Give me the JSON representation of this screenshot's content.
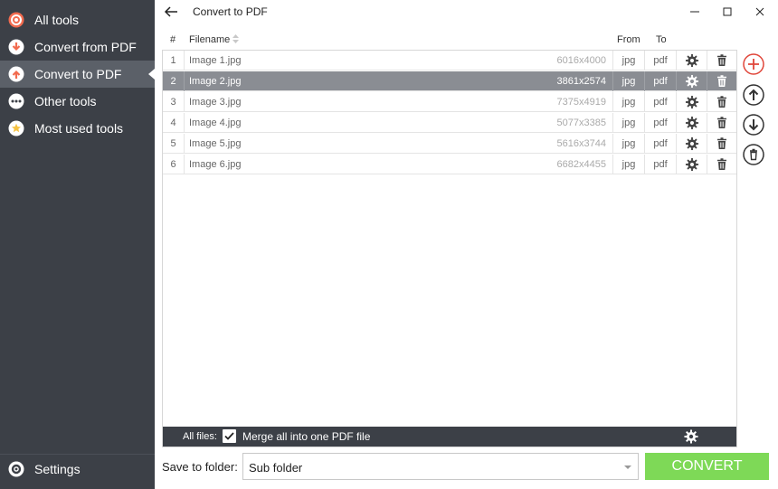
{
  "sidebar": {
    "items": [
      {
        "label": "All tools",
        "icon": "target-icon",
        "color": "#f26b4f"
      },
      {
        "label": "Convert from PDF",
        "icon": "arrow-down-circle-icon",
        "color": "#f26b4f"
      },
      {
        "label": "Convert to PDF",
        "icon": "arrow-up-circle-icon",
        "color": "#f26b4f"
      },
      {
        "label": "Other tools",
        "icon": "ellipsis-circle-icon",
        "color": "#ffffff"
      },
      {
        "label": "Most used tools",
        "icon": "star-circle-icon",
        "color": "#f5c242"
      }
    ],
    "active_index": 2,
    "settings_label": "Settings"
  },
  "titlebar": {
    "title": "Convert to PDF"
  },
  "table": {
    "headers": {
      "num": "#",
      "filename": "Filename",
      "from": "From",
      "to": "To"
    },
    "rows": [
      {
        "num": "1",
        "name": "Image 1.jpg",
        "dims": "6016x4000",
        "from": "jpg",
        "to": "pdf"
      },
      {
        "num": "2",
        "name": "Image 2.jpg",
        "dims": "3861x2574",
        "from": "jpg",
        "to": "pdf"
      },
      {
        "num": "3",
        "name": "Image 3.jpg",
        "dims": "7375x4919",
        "from": "jpg",
        "to": "pdf"
      },
      {
        "num": "4",
        "name": "Image 4.jpg",
        "dims": "5077x3385",
        "from": "jpg",
        "to": "pdf"
      },
      {
        "num": "5",
        "name": "Image 5.jpg",
        "dims": "5616x3744",
        "from": "jpg",
        "to": "pdf"
      },
      {
        "num": "6",
        "name": "Image 6.jpg",
        "dims": "6682x4455",
        "from": "jpg",
        "to": "pdf"
      }
    ],
    "selected_row": 1
  },
  "allfiles": {
    "label": "All files:",
    "merge_label": "Merge all into one PDF file",
    "merge_checked": true
  },
  "footer": {
    "save_label": "Save to folder:",
    "folder_value": "Sub folder",
    "convert_label": "CONVERT"
  },
  "colors": {
    "accent_green": "#7ed957",
    "sidebar_bg": "#3c4047",
    "add_red": "#e0463a",
    "selected_row": "#8a8d93"
  }
}
